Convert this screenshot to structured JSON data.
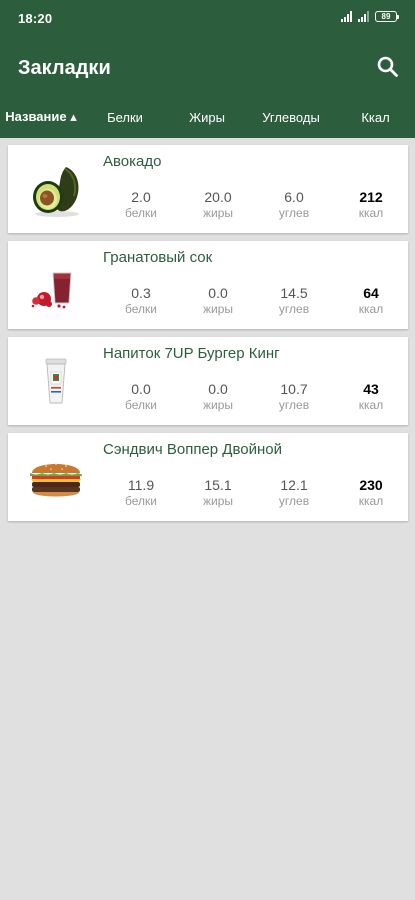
{
  "status_bar": {
    "time": "18:20",
    "battery": "89"
  },
  "app_bar": {
    "title": "Закладки",
    "search_icon": "search-icon"
  },
  "tabs": [
    {
      "label": "Название ▴",
      "active": true
    },
    {
      "label": "Белки"
    },
    {
      "label": "Жиры"
    },
    {
      "label": "Углеводы"
    },
    {
      "label": "Ккал"
    }
  ],
  "labels": {
    "protein": "белки",
    "fat": "жиры",
    "carbs": "углев",
    "kcal": "ккал"
  },
  "items": [
    {
      "name": "Авокадо",
      "icon": "avocado-image",
      "protein": "2.0",
      "fat": "20.0",
      "carbs": "6.0",
      "kcal": "212"
    },
    {
      "name": "Гранатовый сок",
      "icon": "pomegranate-juice-image",
      "protein": "0.3",
      "fat": "0.0",
      "carbs": "14.5",
      "kcal": "64"
    },
    {
      "name": "Напиток 7UP Бургер Кинг",
      "icon": "soda-cup-image",
      "protein": "0.0",
      "fat": "0.0",
      "carbs": "10.7",
      "kcal": "43"
    },
    {
      "name": "Сэндвич Воппер Двойной",
      "icon": "burger-image",
      "protein": "11.9",
      "fat": "15.1",
      "carbs": "12.1",
      "kcal": "230"
    }
  ],
  "colors": {
    "primary": "#2c5e3d",
    "background": "#e0e0e0",
    "card": "#ffffff"
  }
}
